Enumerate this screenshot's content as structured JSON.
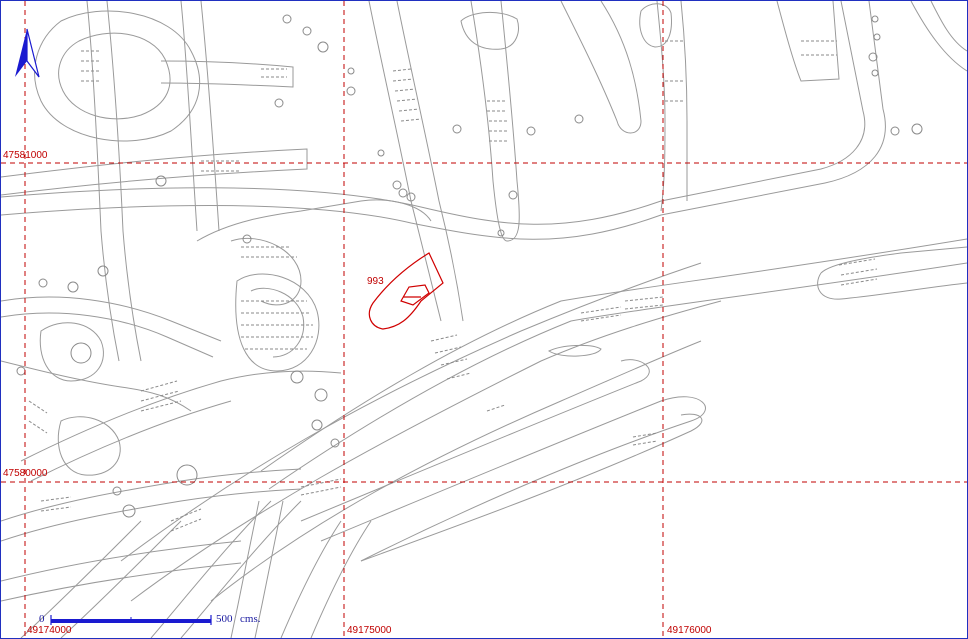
{
  "map": {
    "background": "#ffffff",
    "line_color": "#9a9a9a",
    "grid_color": "#c00000",
    "highlight_color": "#d00000",
    "frame_color": "#2030c0"
  },
  "grid": {
    "northings": [
      "47581000",
      "47580000"
    ],
    "eastings": [
      "49174000",
      "49175000",
      "49176000"
    ]
  },
  "highlight": {
    "label": "993"
  },
  "north_arrow": {
    "icon": "north-arrow-icon"
  },
  "scale_bar": {
    "start_label": "0",
    "end_label": "500",
    "unit_label": "cms."
  }
}
